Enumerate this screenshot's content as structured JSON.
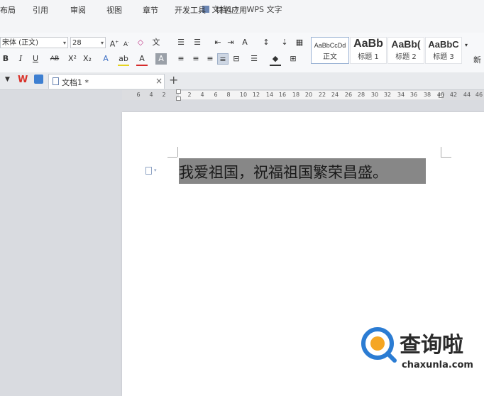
{
  "window": {
    "title": "文档1 * - WPS 文字"
  },
  "menu": [
    "布局",
    "引用",
    "审阅",
    "视图",
    "章节",
    "开发工具",
    "特色应用"
  ],
  "ribbon": {
    "font_name": "宋体 (正文)",
    "font_size": "28",
    "styles": [
      {
        "sample": "AaBbCcDd",
        "label": "正文"
      },
      {
        "sample": "AaBb",
        "label": "标题 1"
      },
      {
        "sample": "AaBb(",
        "label": "标题 2"
      },
      {
        "sample": "AaBbC",
        "label": "标题 3"
      }
    ],
    "new_style_label": "新"
  },
  "tabs": {
    "doc_tab_label": "文档1 *",
    "close_glyph": "×",
    "add_glyph": "+"
  },
  "ruler": {
    "labels": [
      "6",
      "4",
      "2",
      "2",
      "4",
      "6",
      "8",
      "10",
      "12",
      "14",
      "16",
      "18",
      "20",
      "22",
      "24",
      "26",
      "28",
      "30",
      "32",
      "34",
      "36",
      "38",
      "40",
      "42",
      "44",
      "46"
    ]
  },
  "document": {
    "text": "我爱祖国，祝福祖国繁荣昌盛。"
  },
  "watermark": {
    "brand": "查询啦",
    "url": "chaxunla.com"
  },
  "colors": {
    "accent_blue": "#2b7cd3",
    "watermark_orange": "#f5a623",
    "selection_gray": "#878787"
  }
}
